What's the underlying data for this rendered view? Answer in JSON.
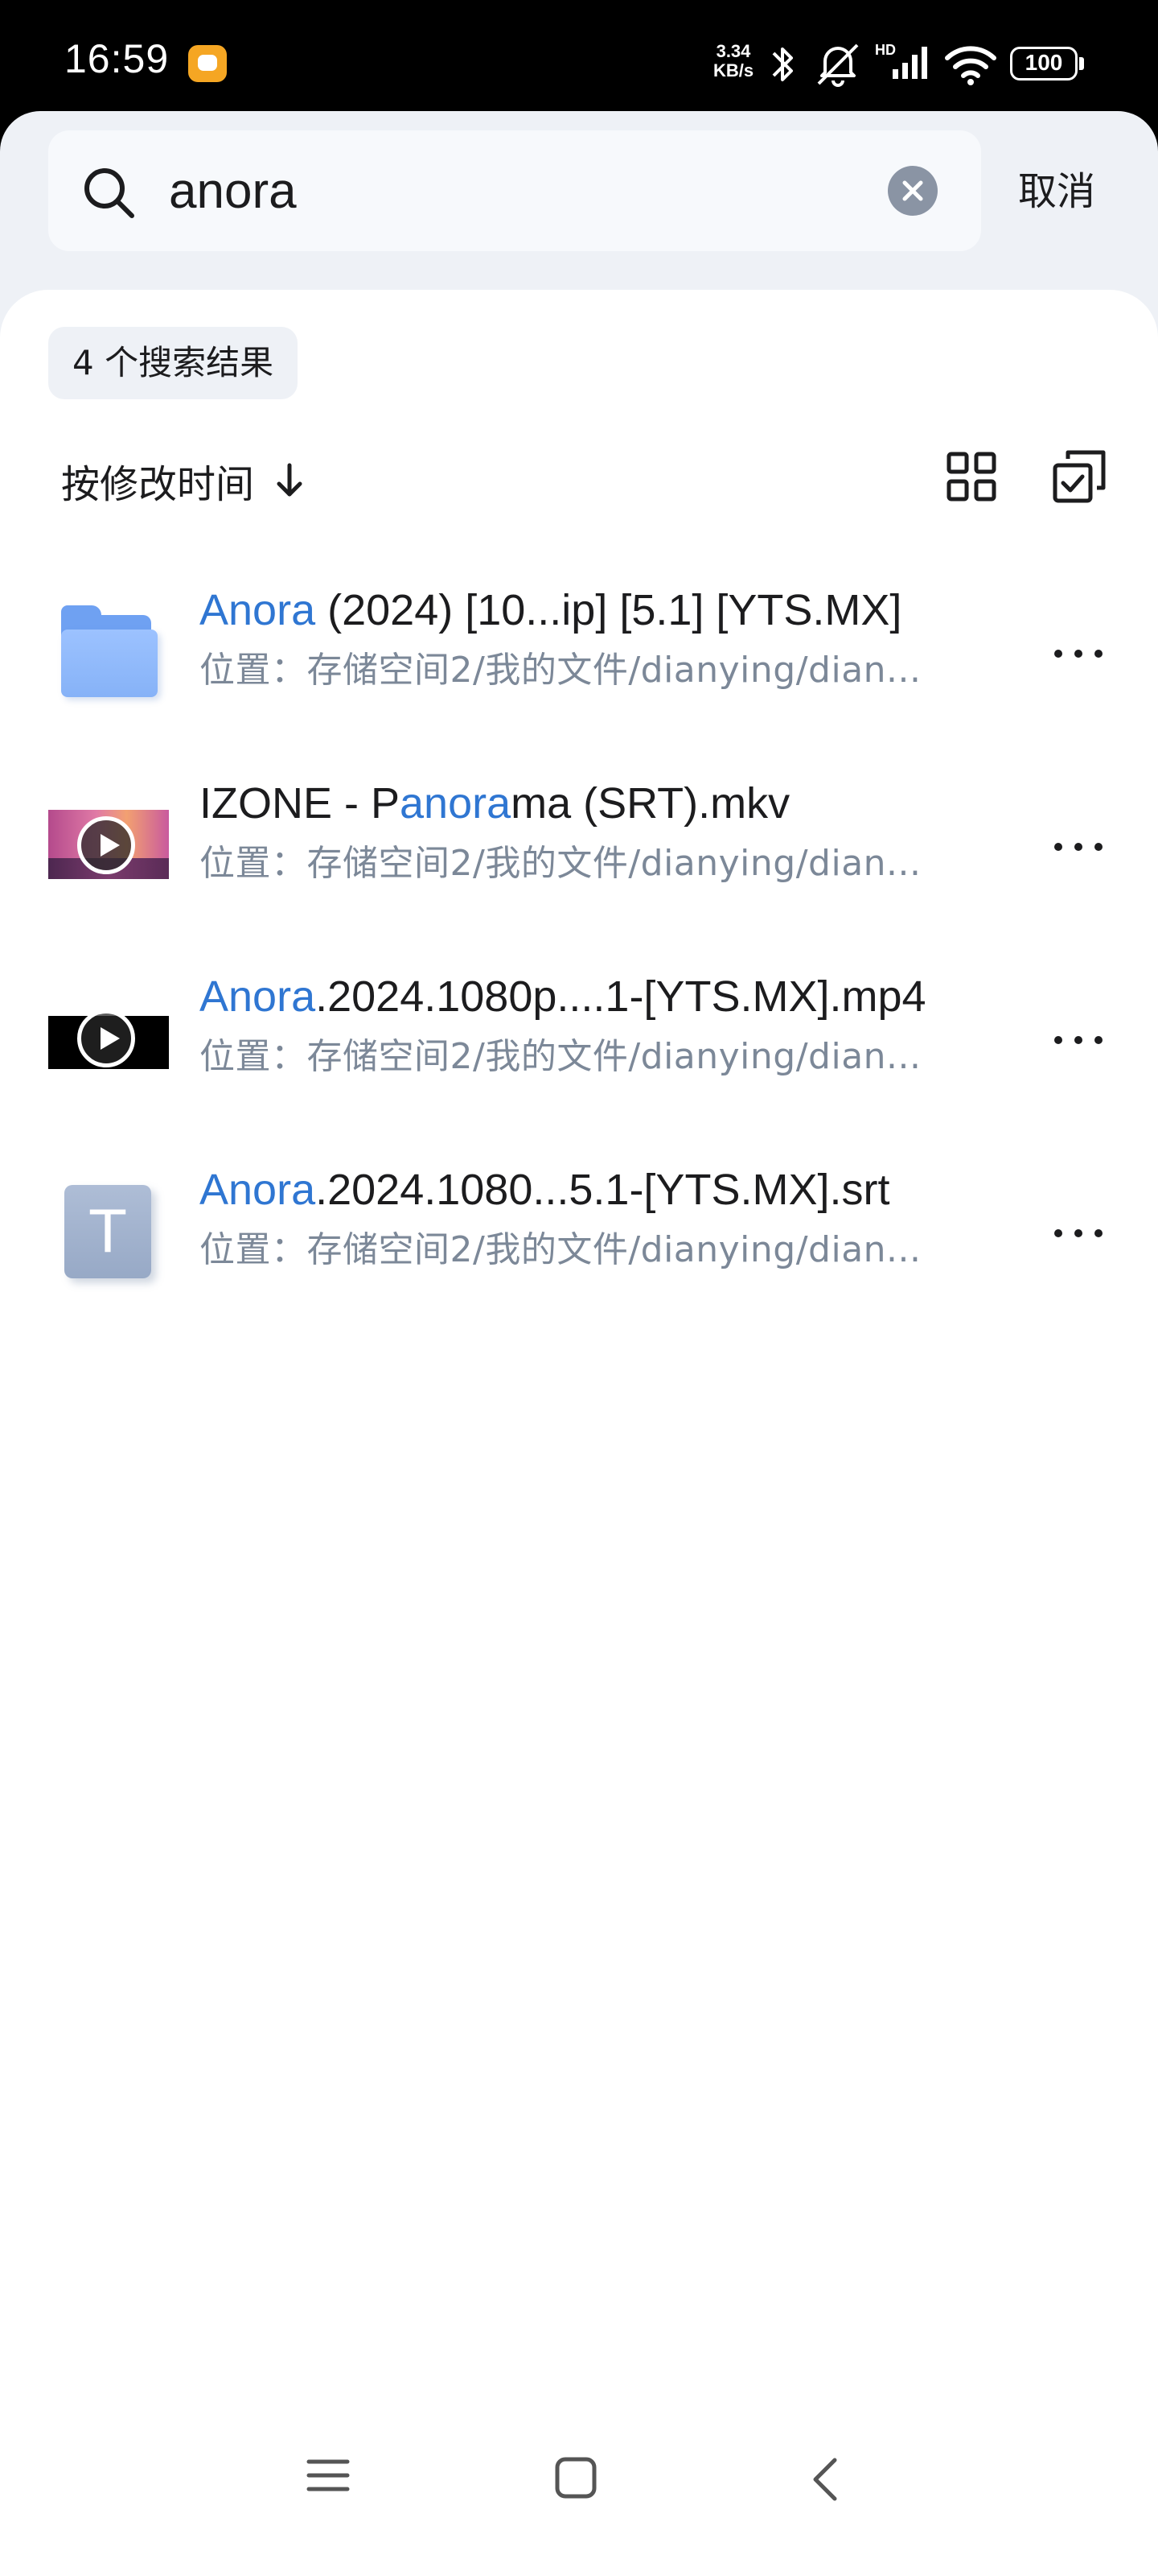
{
  "status_bar": {
    "time": "16:59",
    "net_speed_value": "3.34",
    "net_speed_unit": "KB/s",
    "signal_label": "HD",
    "battery": "100"
  },
  "search": {
    "query": "anora",
    "placeholder": "",
    "cancel_label": "取消"
  },
  "results": {
    "count_label": "4 个搜索结果",
    "sort_label": "按修改时间"
  },
  "files": [
    {
      "type": "folder",
      "icon": "folder-icon",
      "name_parts": [
        {
          "text": "Anora",
          "hl": true
        },
        {
          "text": " (2024) [10...ip] [5.1] [YTS.MX]",
          "hl": false
        }
      ],
      "path": "位置：存储空间2/我的文件/dianying/dian..."
    },
    {
      "type": "video",
      "icon": "video-thumbnail",
      "name_parts": [
        {
          "text": "IZONE - P",
          "hl": false
        },
        {
          "text": "anora",
          "hl": true
        },
        {
          "text": "ma (SRT).mkv",
          "hl": false
        }
      ],
      "path": "位置：存储空间2/我的文件/dianying/dian..."
    },
    {
      "type": "video",
      "icon": "video-thumbnail",
      "name_parts": [
        {
          "text": "Anora",
          "hl": true
        },
        {
          "text": ".2024.1080p....1-[YTS.MX].mp4",
          "hl": false
        }
      ],
      "path": "位置：存储空间2/我的文件/dianying/dian..."
    },
    {
      "type": "text",
      "icon": "text-file-icon",
      "thumb_letter": "T",
      "name_parts": [
        {
          "text": "Anora",
          "hl": true
        },
        {
          "text": ".2024.1080...5.1-[YTS.MX].srt",
          "hl": false
        }
      ],
      "path": "位置：存储空间2/我的文件/dianying/dian..."
    }
  ],
  "colors": {
    "highlight": "#2f76d2",
    "path_text": "#7c8898",
    "folder": "#86b2f7"
  }
}
